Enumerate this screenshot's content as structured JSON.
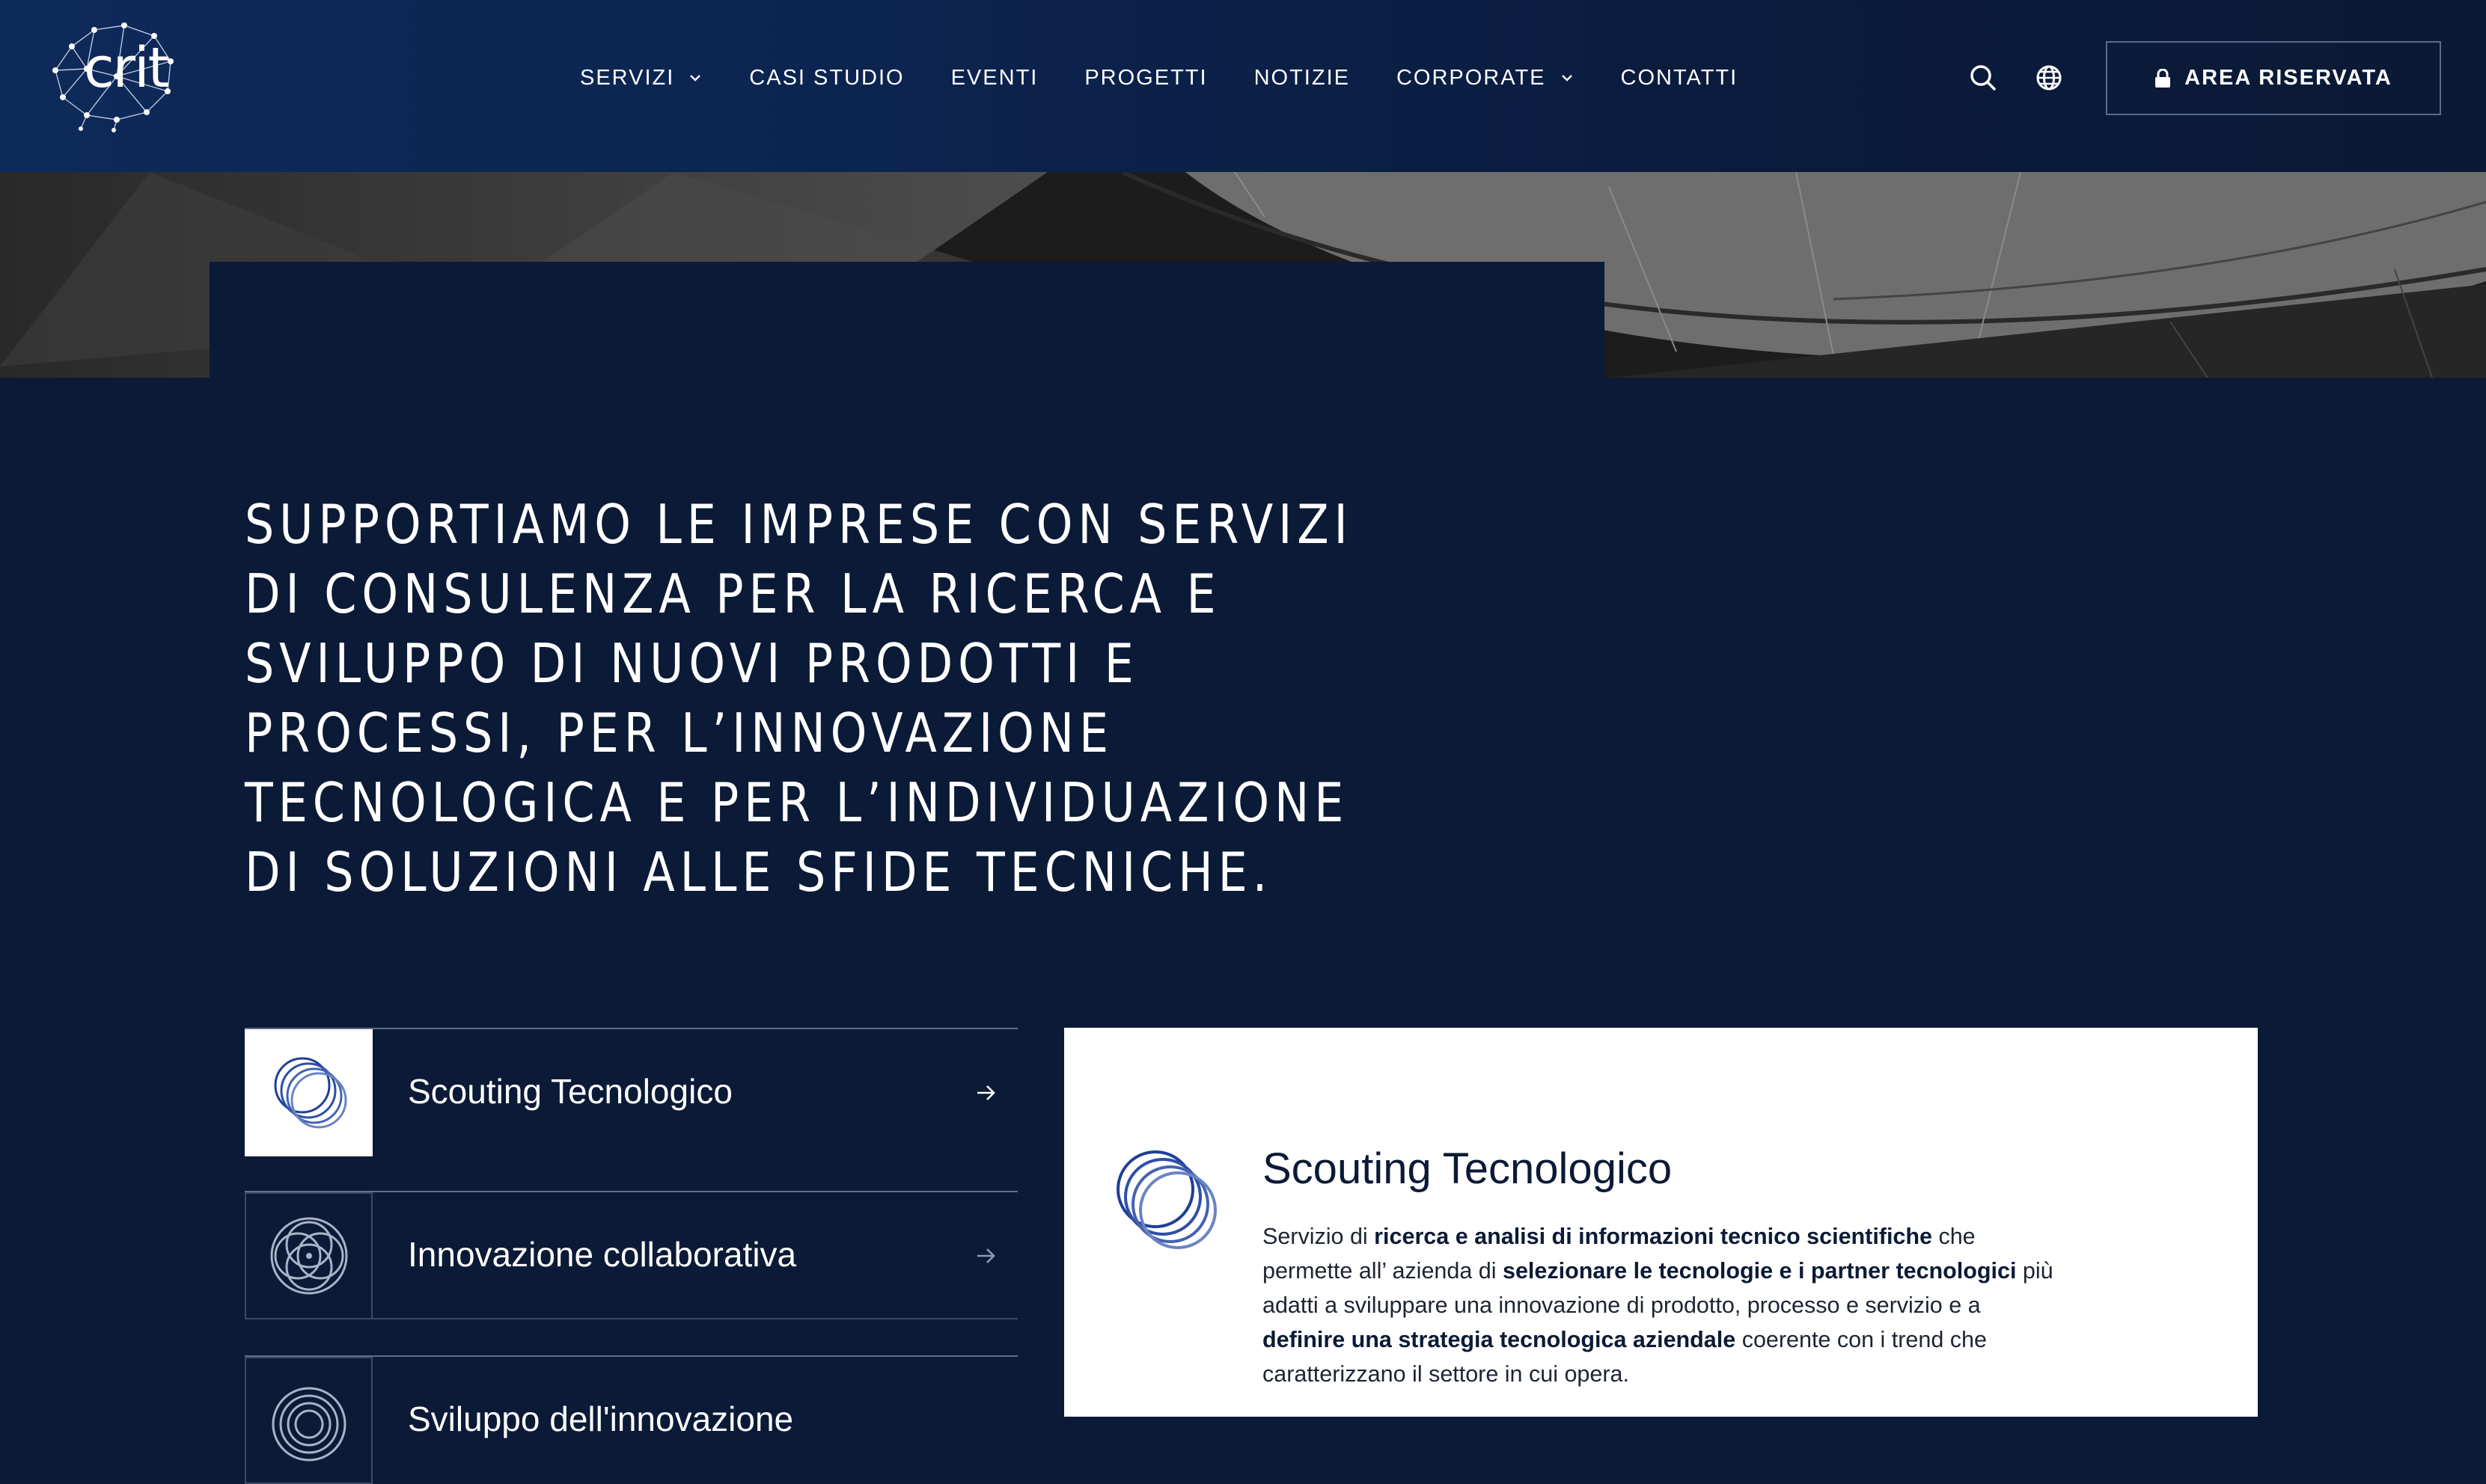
{
  "brand": {
    "logo_text": "crit"
  },
  "nav": {
    "items": [
      {
        "label": "SERVIZI",
        "has_dropdown": true
      },
      {
        "label": "CASI STUDIO",
        "has_dropdown": false
      },
      {
        "label": "EVENTI",
        "has_dropdown": false
      },
      {
        "label": "PROGETTI",
        "has_dropdown": false
      },
      {
        "label": "NOTIZIE",
        "has_dropdown": false
      },
      {
        "label": "CORPORATE",
        "has_dropdown": true
      },
      {
        "label": "CONTATTI",
        "has_dropdown": false
      }
    ],
    "icons": [
      "search-icon",
      "globe-icon"
    ],
    "area_button": {
      "label": "AREA RISERVATA",
      "icon": "lock-icon"
    }
  },
  "main": {
    "headline": "SUPPORTIAMO LE IMPRESE CON SERVIZI DI CONSULENZA PER LA RICERCA E SVILUPPO DI NUOVI PRODOTTI E PROCESSI, PER L’INNOVAZIONE TECNOLOGICA E PER L’INDIVIDUAZIONE DI SOLUZIONI ALLE SFIDE TECNICHE.",
    "services": [
      {
        "label": "Scouting Tecnologico",
        "active": true,
        "icon": "overlapping-circles-icon"
      },
      {
        "label": "Innovazione collaborativa",
        "active": false,
        "icon": "intersecting-circles-icon"
      },
      {
        "label": "Sviluppo dell'innovazione",
        "active": false,
        "icon": "concentric-circles-icon"
      }
    ],
    "detail": {
      "title": "Scouting Tecnologico",
      "desc": [
        {
          "t": "Servizio di ",
          "b": false
        },
        {
          "t": "ricerca e analisi di informazioni tecnico scientifiche",
          "b": true
        },
        {
          "t": " che permette all’ azienda di ",
          "b": false
        },
        {
          "t": "selezionare le tecnologie e i partner tecnologici",
          "b": true
        },
        {
          "t": " più adatti a sviluppare una innovazione di prodotto, processo e servizio e a ",
          "b": false
        },
        {
          "t": "definire una strategia tecnologica aziendale",
          "b": true
        },
        {
          "t": " coerente con i trend che caratterizzano il settore in cui opera.",
          "b": false
        }
      ]
    }
  },
  "colors": {
    "background": "#0b1a36",
    "accent": "#2a4da6",
    "white": "#ffffff"
  }
}
